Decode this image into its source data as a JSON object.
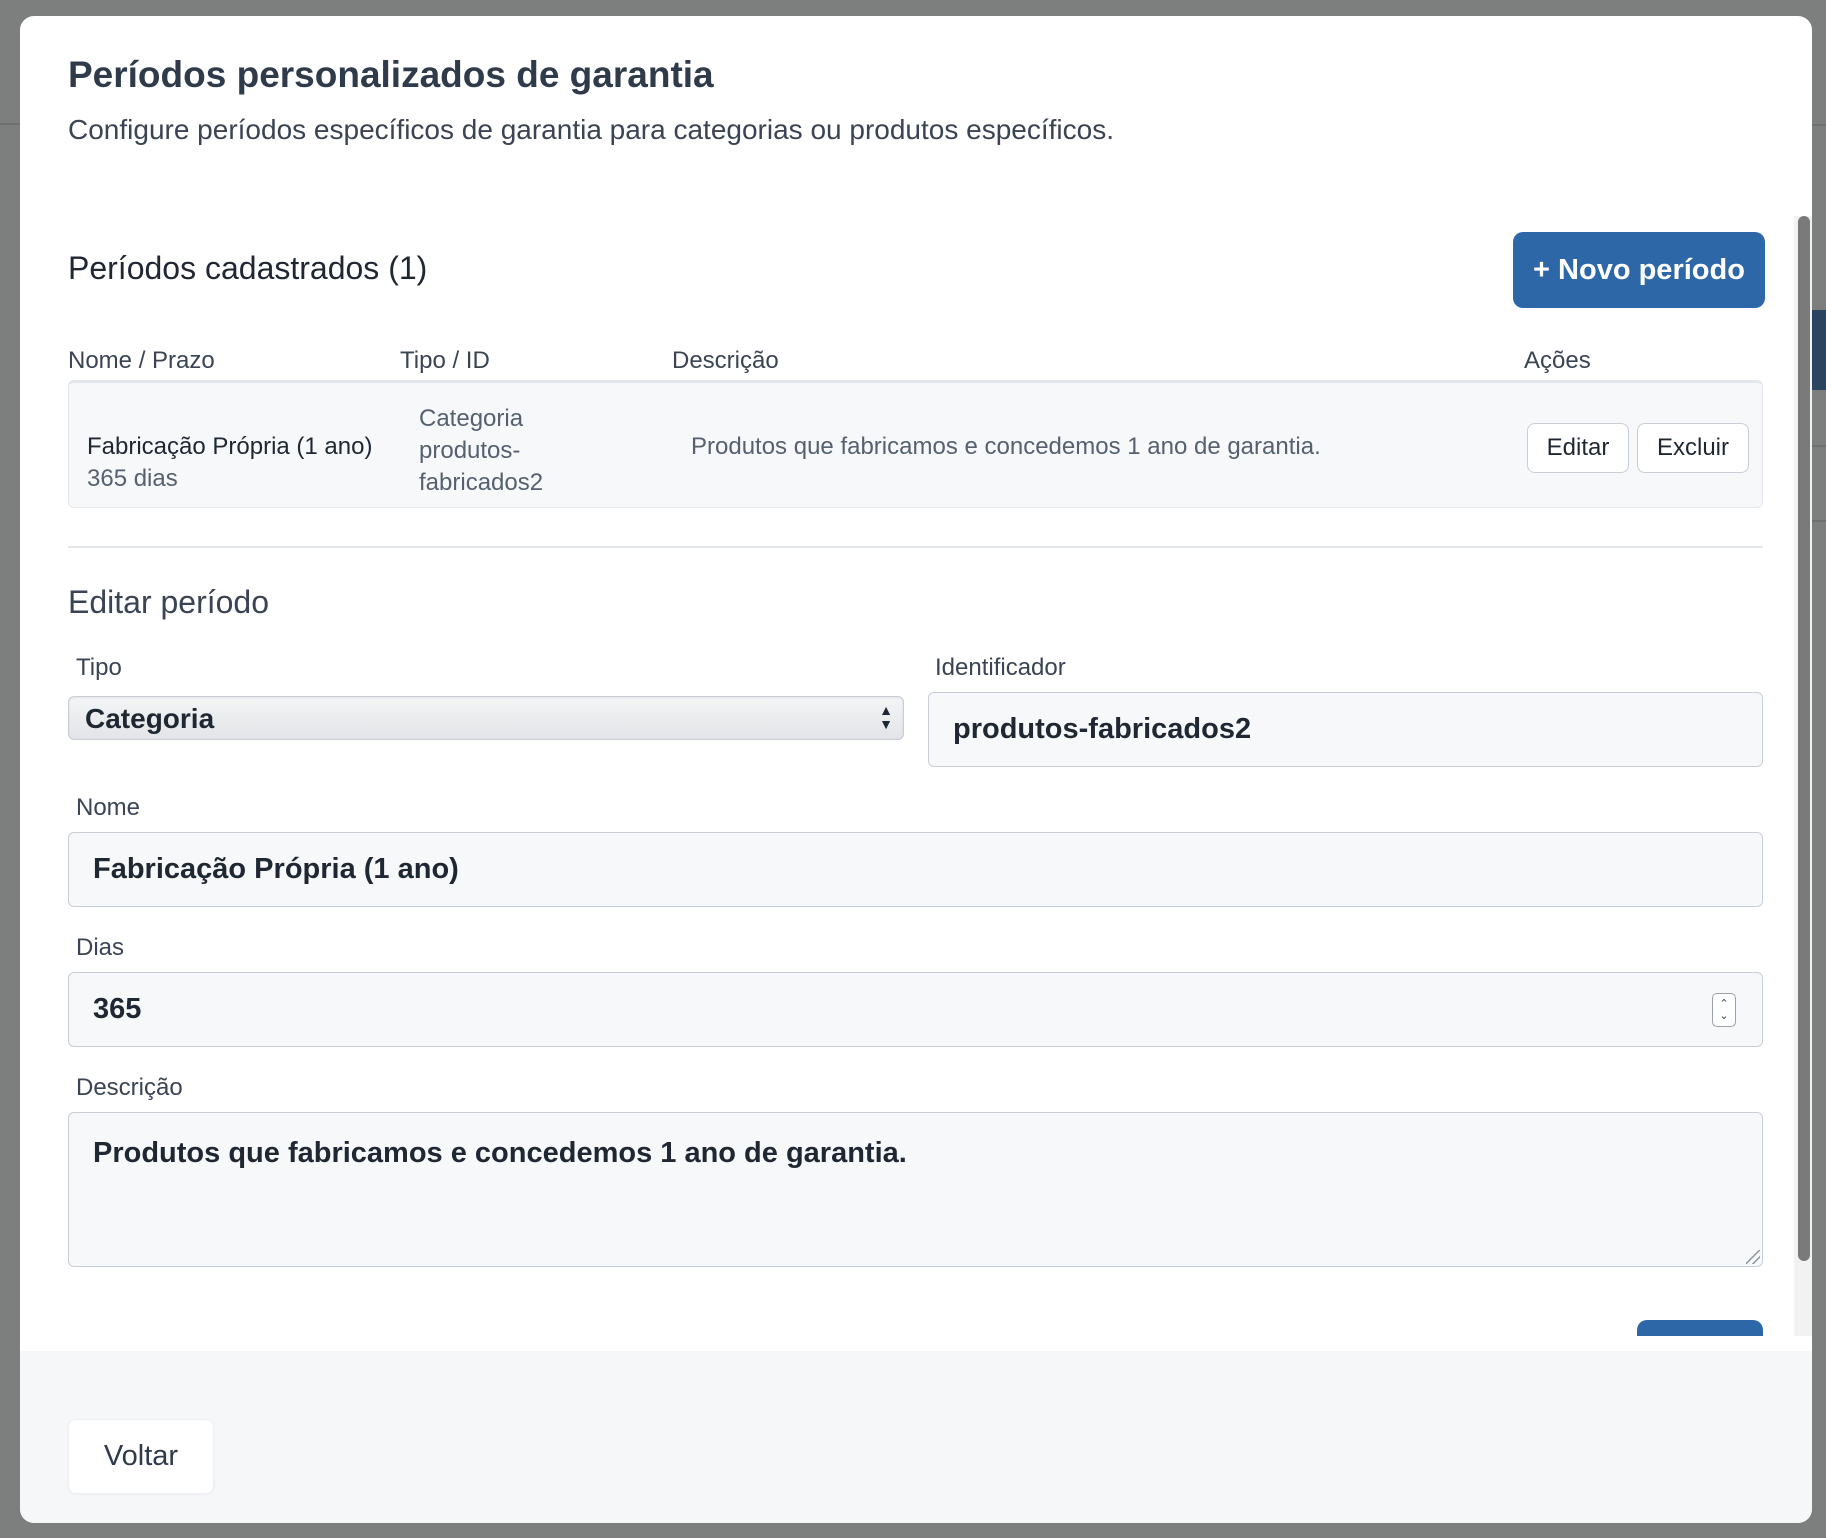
{
  "modal": {
    "title": "Períodos personalizados de garantia",
    "subtitle": "Configure períodos específicos de garantia para categorias ou produtos específicos."
  },
  "list": {
    "title": "Períodos cadastrados (1)",
    "new_button": "+ Novo período",
    "columns": [
      "Nome / Prazo",
      "Tipo / ID",
      "Descrição",
      "Ações"
    ],
    "rows": [
      {
        "name": "Fabricação Própria (1 ano)",
        "days": "365 dias",
        "type_line1": "Categoria",
        "type_line2": "produtos-",
        "type_line3": "fabricados2",
        "description": "Produtos que fabricamos e concedemos 1 ano de garantia.",
        "edit_label": "Editar",
        "delete_label": "Excluir"
      }
    ]
  },
  "edit_form": {
    "title": "Editar período",
    "tipo_label": "Tipo",
    "tipo_value": "Categoria",
    "identificador_label": "Identificador",
    "identificador_value": "produtos-fabricados2",
    "nome_label": "Nome",
    "nome_value": "Fabricação Própria (1 ano)",
    "dias_label": "Dias",
    "dias_value": "365",
    "descricao_label": "Descrição",
    "descricao_value": "Produtos que fabricamos e concedemos 1 ano de garantia."
  },
  "footer": {
    "back_button": "Voltar"
  },
  "colors": {
    "primary": "#2e67a8",
    "overlay": "#7d7e7e",
    "text": "#1f2733"
  }
}
